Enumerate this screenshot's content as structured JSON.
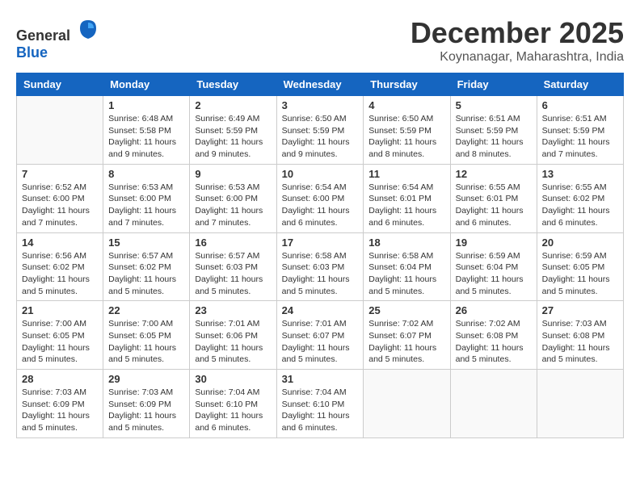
{
  "header": {
    "logo_general": "General",
    "logo_blue": "Blue",
    "month": "December 2025",
    "location": "Koynanagar, Maharashtra, India"
  },
  "days_of_week": [
    "Sunday",
    "Monday",
    "Tuesday",
    "Wednesday",
    "Thursday",
    "Friday",
    "Saturday"
  ],
  "weeks": [
    [
      {
        "day": "",
        "info": ""
      },
      {
        "day": "1",
        "info": "Sunrise: 6:48 AM\nSunset: 5:58 PM\nDaylight: 11 hours\nand 9 minutes."
      },
      {
        "day": "2",
        "info": "Sunrise: 6:49 AM\nSunset: 5:59 PM\nDaylight: 11 hours\nand 9 minutes."
      },
      {
        "day": "3",
        "info": "Sunrise: 6:50 AM\nSunset: 5:59 PM\nDaylight: 11 hours\nand 9 minutes."
      },
      {
        "day": "4",
        "info": "Sunrise: 6:50 AM\nSunset: 5:59 PM\nDaylight: 11 hours\nand 8 minutes."
      },
      {
        "day": "5",
        "info": "Sunrise: 6:51 AM\nSunset: 5:59 PM\nDaylight: 11 hours\nand 8 minutes."
      },
      {
        "day": "6",
        "info": "Sunrise: 6:51 AM\nSunset: 5:59 PM\nDaylight: 11 hours\nand 7 minutes."
      }
    ],
    [
      {
        "day": "7",
        "info": "Sunrise: 6:52 AM\nSunset: 6:00 PM\nDaylight: 11 hours\nand 7 minutes."
      },
      {
        "day": "8",
        "info": "Sunrise: 6:53 AM\nSunset: 6:00 PM\nDaylight: 11 hours\nand 7 minutes."
      },
      {
        "day": "9",
        "info": "Sunrise: 6:53 AM\nSunset: 6:00 PM\nDaylight: 11 hours\nand 7 minutes."
      },
      {
        "day": "10",
        "info": "Sunrise: 6:54 AM\nSunset: 6:00 PM\nDaylight: 11 hours\nand 6 minutes."
      },
      {
        "day": "11",
        "info": "Sunrise: 6:54 AM\nSunset: 6:01 PM\nDaylight: 11 hours\nand 6 minutes."
      },
      {
        "day": "12",
        "info": "Sunrise: 6:55 AM\nSunset: 6:01 PM\nDaylight: 11 hours\nand 6 minutes."
      },
      {
        "day": "13",
        "info": "Sunrise: 6:55 AM\nSunset: 6:02 PM\nDaylight: 11 hours\nand 6 minutes."
      }
    ],
    [
      {
        "day": "14",
        "info": "Sunrise: 6:56 AM\nSunset: 6:02 PM\nDaylight: 11 hours\nand 5 minutes."
      },
      {
        "day": "15",
        "info": "Sunrise: 6:57 AM\nSunset: 6:02 PM\nDaylight: 11 hours\nand 5 minutes."
      },
      {
        "day": "16",
        "info": "Sunrise: 6:57 AM\nSunset: 6:03 PM\nDaylight: 11 hours\nand 5 minutes."
      },
      {
        "day": "17",
        "info": "Sunrise: 6:58 AM\nSunset: 6:03 PM\nDaylight: 11 hours\nand 5 minutes."
      },
      {
        "day": "18",
        "info": "Sunrise: 6:58 AM\nSunset: 6:04 PM\nDaylight: 11 hours\nand 5 minutes."
      },
      {
        "day": "19",
        "info": "Sunrise: 6:59 AM\nSunset: 6:04 PM\nDaylight: 11 hours\nand 5 minutes."
      },
      {
        "day": "20",
        "info": "Sunrise: 6:59 AM\nSunset: 6:05 PM\nDaylight: 11 hours\nand 5 minutes."
      }
    ],
    [
      {
        "day": "21",
        "info": "Sunrise: 7:00 AM\nSunset: 6:05 PM\nDaylight: 11 hours\nand 5 minutes."
      },
      {
        "day": "22",
        "info": "Sunrise: 7:00 AM\nSunset: 6:05 PM\nDaylight: 11 hours\nand 5 minutes."
      },
      {
        "day": "23",
        "info": "Sunrise: 7:01 AM\nSunset: 6:06 PM\nDaylight: 11 hours\nand 5 minutes."
      },
      {
        "day": "24",
        "info": "Sunrise: 7:01 AM\nSunset: 6:07 PM\nDaylight: 11 hours\nand 5 minutes."
      },
      {
        "day": "25",
        "info": "Sunrise: 7:02 AM\nSunset: 6:07 PM\nDaylight: 11 hours\nand 5 minutes."
      },
      {
        "day": "26",
        "info": "Sunrise: 7:02 AM\nSunset: 6:08 PM\nDaylight: 11 hours\nand 5 minutes."
      },
      {
        "day": "27",
        "info": "Sunrise: 7:03 AM\nSunset: 6:08 PM\nDaylight: 11 hours\nand 5 minutes."
      }
    ],
    [
      {
        "day": "28",
        "info": "Sunrise: 7:03 AM\nSunset: 6:09 PM\nDaylight: 11 hours\nand 5 minutes."
      },
      {
        "day": "29",
        "info": "Sunrise: 7:03 AM\nSunset: 6:09 PM\nDaylight: 11 hours\nand 5 minutes."
      },
      {
        "day": "30",
        "info": "Sunrise: 7:04 AM\nSunset: 6:10 PM\nDaylight: 11 hours\nand 6 minutes."
      },
      {
        "day": "31",
        "info": "Sunrise: 7:04 AM\nSunset: 6:10 PM\nDaylight: 11 hours\nand 6 minutes."
      },
      {
        "day": "",
        "info": ""
      },
      {
        "day": "",
        "info": ""
      },
      {
        "day": "",
        "info": ""
      }
    ]
  ]
}
